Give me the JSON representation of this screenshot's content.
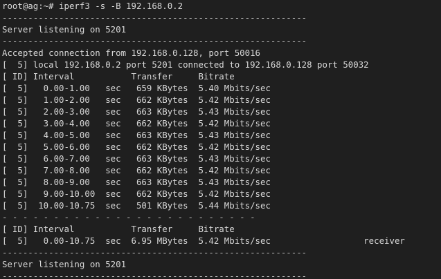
{
  "terminal": {
    "lines": [
      "root@ag:~# iperf3 -s -B 192.168.0.2",
      "-----------------------------------------------------------",
      "Server listening on 5201",
      "-----------------------------------------------------------",
      "Accepted connection from 192.168.0.128, port 50016",
      "[  5] local 192.168.0.2 port 5201 connected to 192.168.0.128 port 50032",
      "[ ID] Interval           Transfer     Bitrate",
      "[  5]   0.00-1.00   sec   659 KBytes  5.40 Mbits/sec",
      "[  5]   1.00-2.00   sec   662 KBytes  5.42 Mbits/sec",
      "[  5]   2.00-3.00   sec   663 KBytes  5.43 Mbits/sec",
      "[  5]   3.00-4.00   sec   662 KBytes  5.42 Mbits/sec",
      "[  5]   4.00-5.00   sec   663 KBytes  5.43 Mbits/sec",
      "[  5]   5.00-6.00   sec   662 KBytes  5.42 Mbits/sec",
      "[  5]   6.00-7.00   sec   663 KBytes  5.43 Mbits/sec",
      "[  5]   7.00-8.00   sec   662 KBytes  5.42 Mbits/sec",
      "[  5]   8.00-9.00   sec   663 KBytes  5.43 Mbits/sec",
      "[  5]   9.00-10.00  sec   662 KBytes  5.42 Mbits/sec",
      "[  5]  10.00-10.75  sec   501 KBytes  5.44 Mbits/sec",
      "- - - - - - - - - - - - - - - - - - - - - - - - -",
      "[ ID] Interval           Transfer     Bitrate",
      "[  5]   0.00-10.75  sec  6.95 MBytes  5.42 Mbits/sec                  receiver",
      "-----------------------------------------------------------",
      "Server listening on 5201",
      "-----------------------------------------------------------"
    ]
  }
}
